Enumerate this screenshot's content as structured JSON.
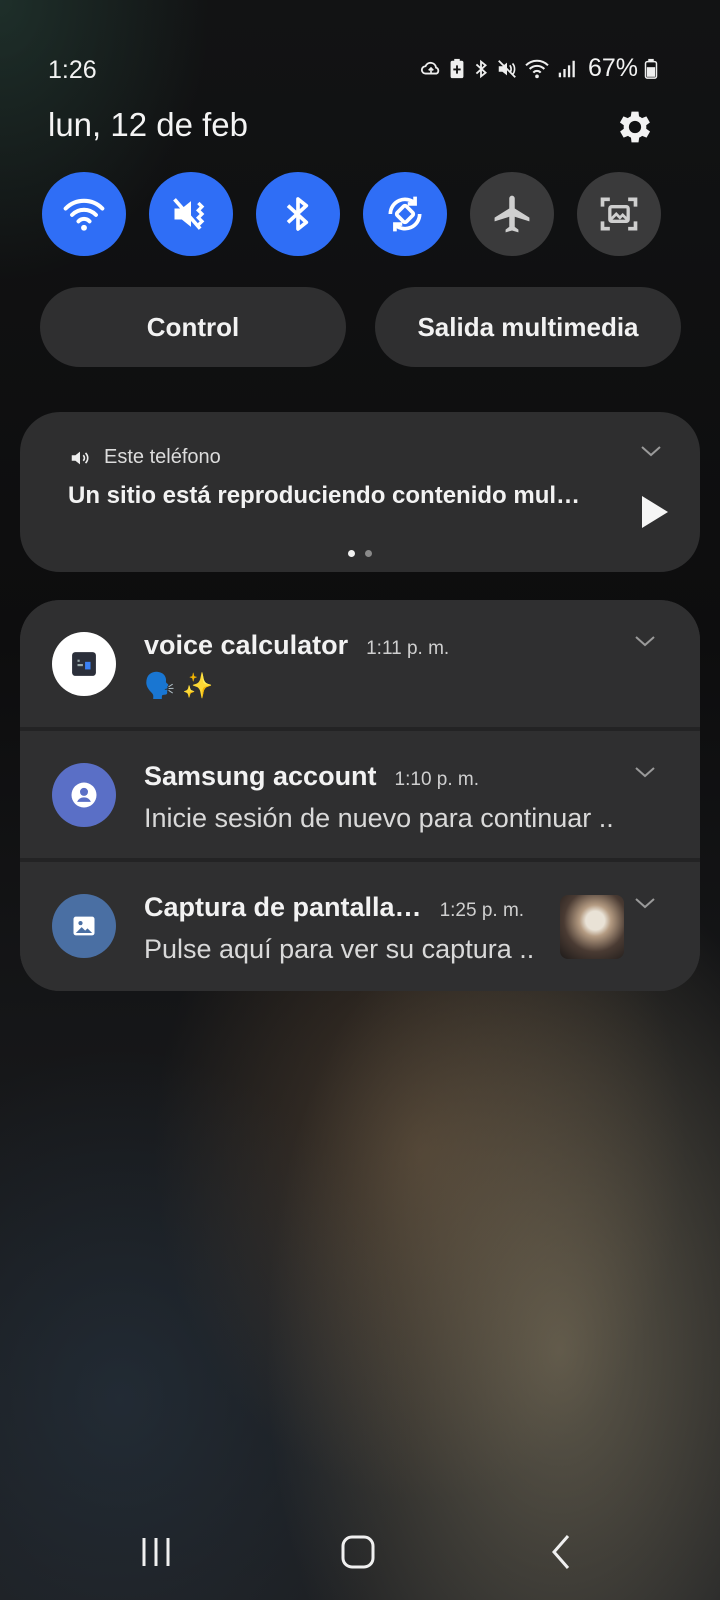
{
  "status_bar": {
    "time": "1:26",
    "battery_percent": "67%"
  },
  "header": {
    "date": "lun, 12 de feb"
  },
  "quick_settings": [
    {
      "name": "wifi",
      "icon": "wifi-icon",
      "on": true
    },
    {
      "name": "sound",
      "icon": "mute-vibrate-icon",
      "on": true
    },
    {
      "name": "bluetooth",
      "icon": "bluetooth-icon",
      "on": true
    },
    {
      "name": "auto-rotate",
      "icon": "rotate-icon",
      "on": true
    },
    {
      "name": "airplane-mode",
      "icon": "airplane-icon",
      "on": false
    },
    {
      "name": "screenshot",
      "icon": "screen-capture-icon",
      "on": false
    }
  ],
  "pills": {
    "control": "Control",
    "media_output": "Salida multimedia"
  },
  "media": {
    "device": "Este teléfono",
    "title": "Un sitio está reproduciendo contenido mul…",
    "page": 1,
    "pages": 2
  },
  "notifications": [
    {
      "app": "voice calculator",
      "time": "1:11 p. m.",
      "text": "🗣️ ✨",
      "icon": "calculator-icon",
      "icon_bg": "#ffffff"
    },
    {
      "app": "Samsung account",
      "time": "1:10 p. m.",
      "text": "Inicie sesión de nuevo para continuar ..",
      "icon": "account-icon",
      "icon_bg": "#5a6fc6"
    },
    {
      "app": "Captura de pantalla…",
      "time": "1:25 p. m.",
      "text": "Pulse aquí para ver su captura ..",
      "icon": "image-icon",
      "icon_bg": "#4a6fa3",
      "has_thumbnail": true
    }
  ],
  "colors": {
    "accent": "#2f6ef6",
    "tile_off": "#3a3a3b",
    "card": "#2f2f30"
  }
}
